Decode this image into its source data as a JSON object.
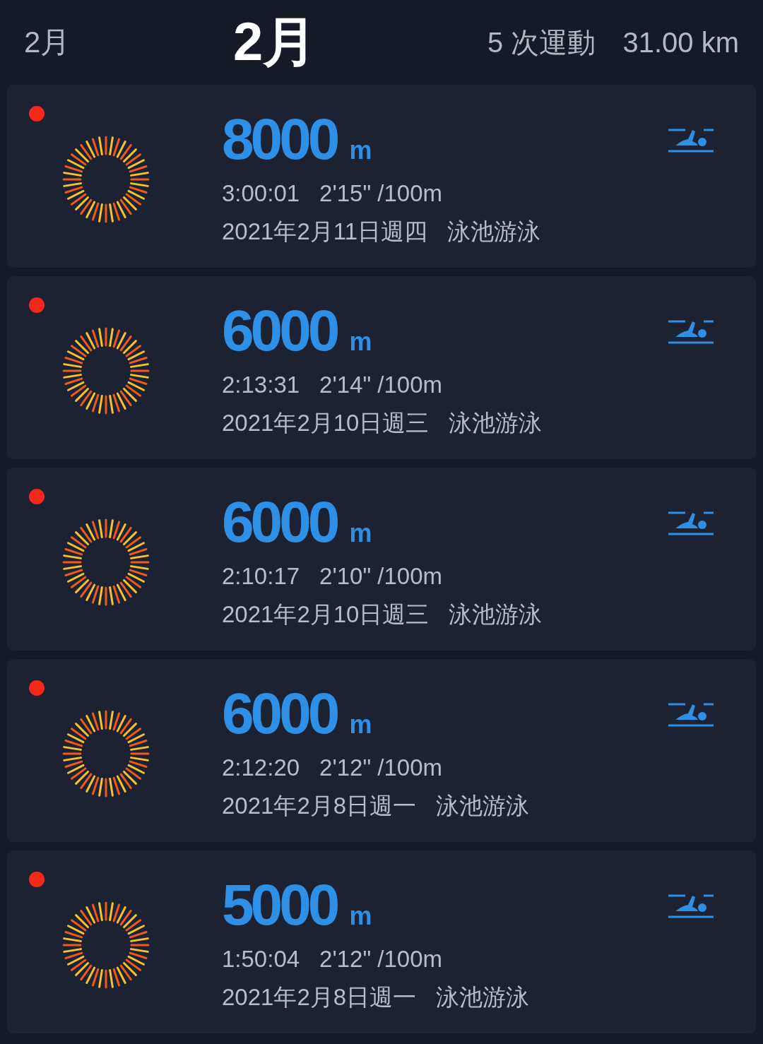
{
  "header": {
    "month_tab": "2月",
    "month_title": "2月",
    "count": "5 次運動",
    "total_distance": "31.00 km"
  },
  "workouts": [
    {
      "new": true,
      "distance": "8000",
      "unit": "m",
      "duration": "3:00:01",
      "pace": "2'15\" /100m",
      "date": "2021年2月11日週四",
      "sport": "泳池游泳",
      "kind": "pool_swim"
    },
    {
      "new": true,
      "distance": "6000",
      "unit": "m",
      "duration": "2:13:31",
      "pace": "2'14\" /100m",
      "date": "2021年2月10日週三",
      "sport": "泳池游泳",
      "kind": "pool_swim"
    },
    {
      "new": true,
      "distance": "6000",
      "unit": "m",
      "duration": "2:10:17",
      "pace": "2'10\" /100m",
      "date": "2021年2月10日週三",
      "sport": "泳池游泳",
      "kind": "pool_swim"
    },
    {
      "new": true,
      "distance": "6000",
      "unit": "m",
      "duration": "2:12:20",
      "pace": "2'12\" /100m",
      "date": "2021年2月8日週一",
      "sport": "泳池游泳",
      "kind": "pool_swim"
    },
    {
      "new": true,
      "distance": "5000",
      "unit": "m",
      "duration": "1:50:04",
      "pace": "2'12\" /100m",
      "date": "2021年2月8日週一",
      "sport": "泳池游泳",
      "kind": "pool_swim"
    }
  ]
}
